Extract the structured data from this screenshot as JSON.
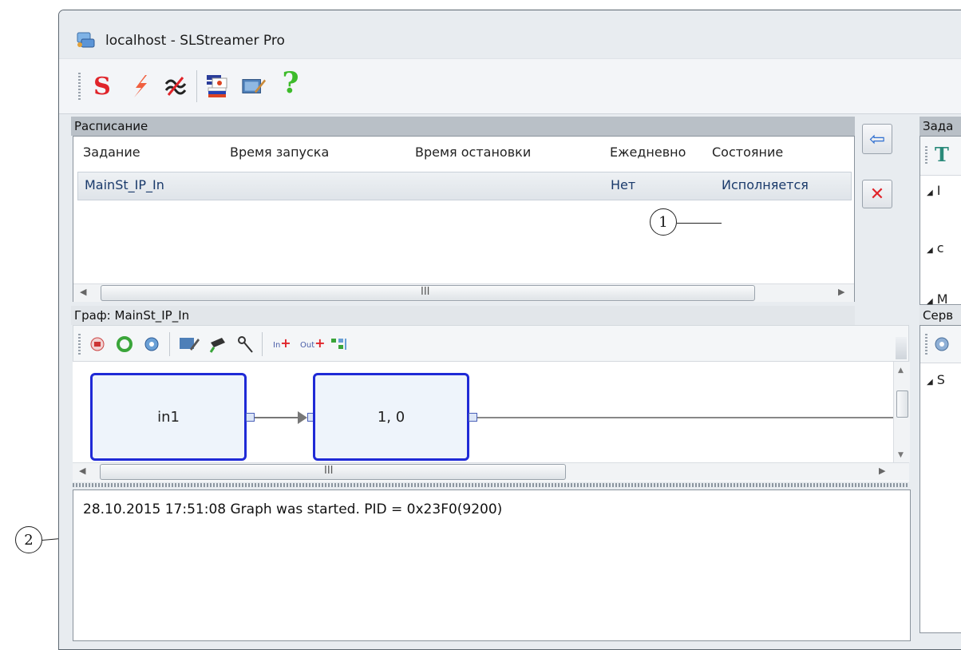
{
  "window": {
    "title": "localhost - SLStreamer Pro"
  },
  "toolbar": {
    "icons": [
      "s-server-icon",
      "lightning-icon",
      "wave-icon",
      "flags-language-icon",
      "edit-screen-icon",
      "help-icon"
    ],
    "help_glyph": "?",
    "s_glyph": "S"
  },
  "schedule": {
    "title": "Расписание",
    "columns": [
      "Задание",
      "Время запуска",
      "Время остановки",
      "Ежедневно",
      "Состояние"
    ],
    "rows": [
      {
        "task": "MainSt_IP_In",
        "start": "",
        "stop": "",
        "daily": "Нет",
        "state": "Исполняется"
      }
    ],
    "scroll_grip": "III"
  },
  "side_buttons": {
    "back_glyph": "⇦",
    "delete_glyph": "✕"
  },
  "graph": {
    "title": "Граф: MainSt_IP_In",
    "nodes": [
      {
        "label": "in1"
      },
      {
        "label": "1, 0"
      }
    ],
    "scroll_grip": "III",
    "port_in": "In",
    "port_out": "Out"
  },
  "log": {
    "lines": [
      "28.10.2015 17:51:08 Graph was started. PID = 0x23F0(9200)"
    ]
  },
  "right_panel": {
    "tasks_title": "Зада",
    "tasks_toolbar_glyph": "T",
    "tasks_tree": [
      "I",
      "c",
      "M"
    ],
    "servers_title": "Серв",
    "servers_tree": [
      "S"
    ]
  },
  "callouts": {
    "one": "1",
    "two": "2"
  },
  "colors": {
    "accent": "#1f2ad6",
    "delete": "#e0242a",
    "back": "#2f6fd0",
    "header_bg": "#b9c0c7"
  }
}
